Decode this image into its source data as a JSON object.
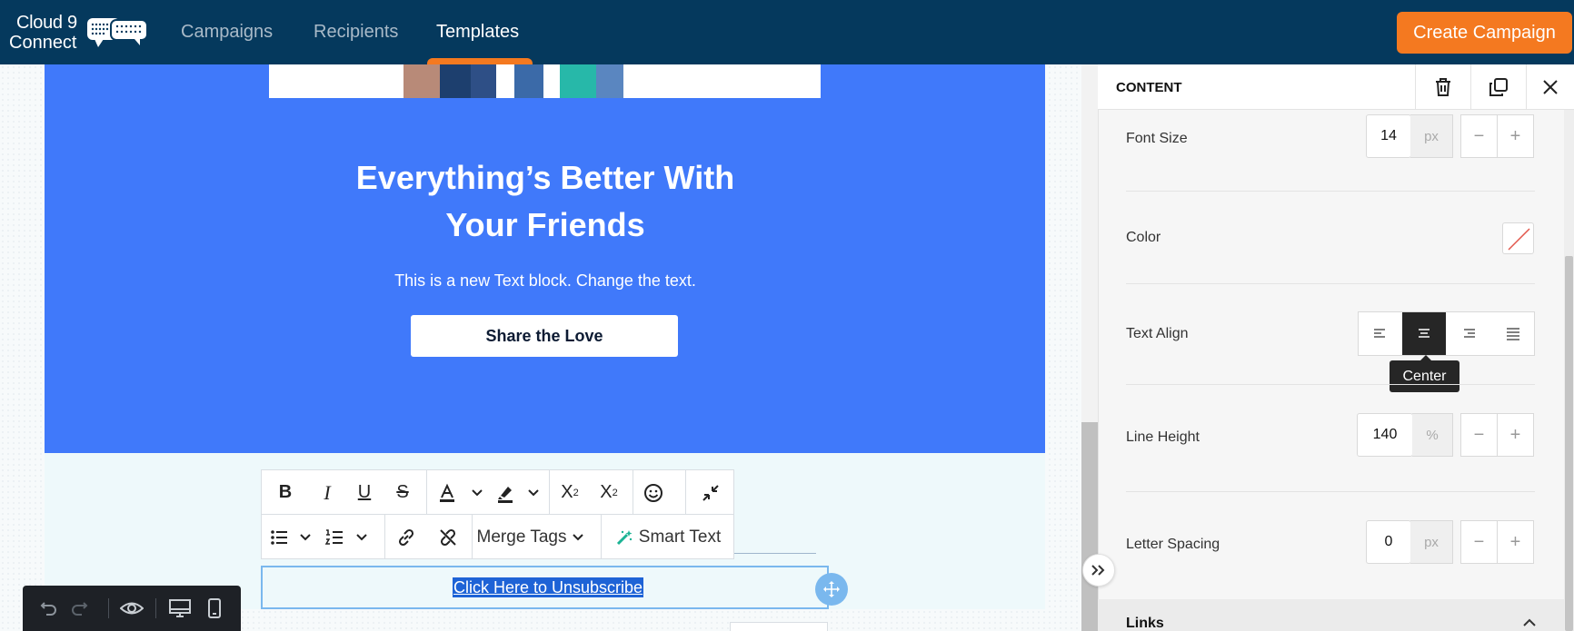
{
  "brand": {
    "line1": "Cloud 9",
    "line2": "Connect"
  },
  "nav": {
    "items": [
      {
        "label": "Campaigns"
      },
      {
        "label": "Recipients"
      },
      {
        "label": "Templates"
      }
    ],
    "active": "Templates",
    "cta_label": "Create Campaign"
  },
  "email": {
    "headline_line1": "Everything’s Better With",
    "headline_line2": "Your Friends",
    "body_text": "This is a new Text block. Change the text.",
    "button_label": "Share the Love",
    "unsubscribe_text": "Click Here to Unsubscribe"
  },
  "text_toolbar": {
    "merge_tags_label": "Merge Tags",
    "smart_text_label": "Smart Text"
  },
  "panel": {
    "title": "CONTENT",
    "font_size": {
      "label": "Font Size",
      "value": "14",
      "unit": "px"
    },
    "color": {
      "label": "Color"
    },
    "text_align": {
      "label": "Text Align",
      "selected": "center",
      "tooltip": "Center"
    },
    "line_height": {
      "label": "Line Height",
      "value": "140",
      "unit": "%"
    },
    "letter_spacing": {
      "label": "Letter Spacing",
      "value": "0",
      "unit": "px"
    },
    "links_section": "Links"
  },
  "colors": {
    "topbar": "#05395d",
    "accent": "#f47920",
    "email_blue": "#4079fa",
    "selection": "#1e63d6"
  }
}
